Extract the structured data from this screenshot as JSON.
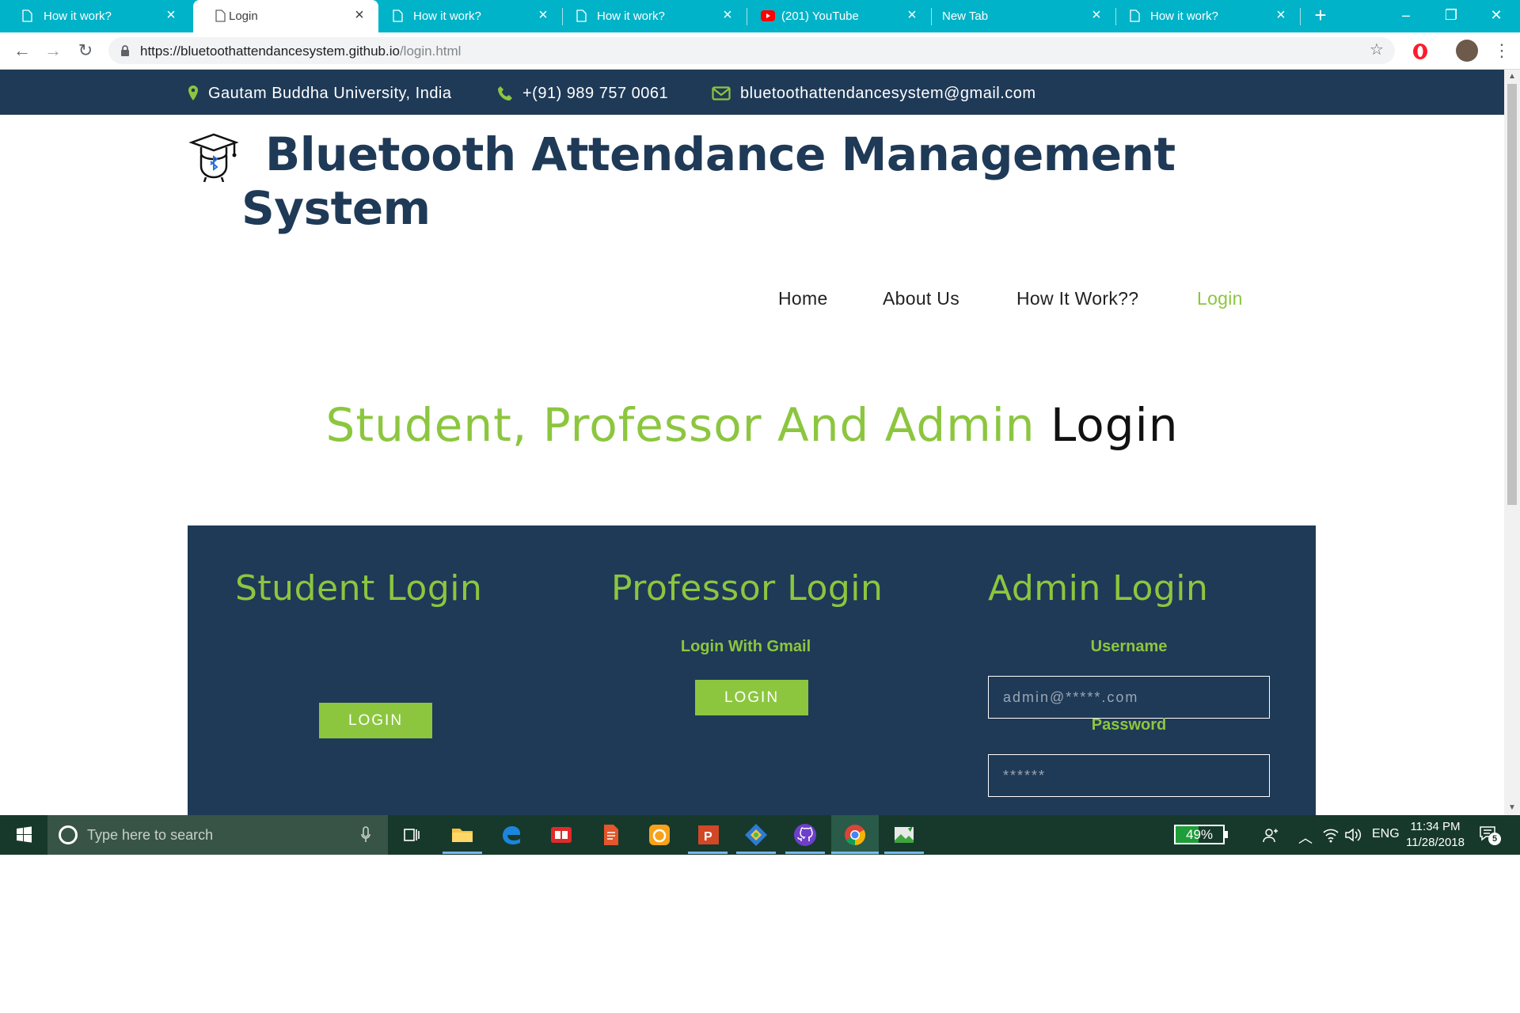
{
  "browser": {
    "tabs": [
      {
        "title": "How it work?",
        "icon": "page-icon",
        "active": false
      },
      {
        "title": "Login",
        "icon": "page-icon",
        "active": true
      },
      {
        "title": "How it work?",
        "icon": "page-icon",
        "active": false
      },
      {
        "title": "How it work?",
        "icon": "page-icon",
        "active": false
      },
      {
        "title": "(201) YouTube",
        "icon": "youtube-icon",
        "active": false
      },
      {
        "title": "New Tab",
        "icon": "none",
        "active": false
      },
      {
        "title": "How it work?",
        "icon": "page-icon",
        "active": false
      }
    ],
    "url_host": "https://bluetoothattendancesystem.github.io",
    "url_path": "/login.html"
  },
  "site": {
    "contact": {
      "location": "Gautam Buddha University, India",
      "phone": "+(91) 989 757 0061",
      "email": "bluetoothattendancesystem@gmail.com"
    },
    "brand_title": "Bluetooth Attendance Management System",
    "nav": [
      {
        "label": "Home",
        "active": false
      },
      {
        "label": "About Us",
        "active": false
      },
      {
        "label": "How It Work??",
        "active": false
      },
      {
        "label": "Login",
        "active": true
      }
    ],
    "heading_green": "Student, Professor And Admin",
    "heading_dark": "Login",
    "student": {
      "title": "Student Login",
      "button": "LOGIN"
    },
    "professor": {
      "title": "Professor Login",
      "subtitle": "Login With Gmail",
      "button": "LOGIN"
    },
    "admin": {
      "title": "Admin Login",
      "username_label": "Username",
      "username_placeholder": "admin@*****.com",
      "password_label": "Password",
      "password_placeholder": "******"
    },
    "colors": {
      "primary": "#1f3a57",
      "accent": "#8cc63f"
    }
  },
  "taskbar": {
    "search_placeholder": "Type here to search",
    "battery": "49%",
    "battery_level": 0.49,
    "language": "ENG",
    "time": "11:34 PM",
    "date": "11/28/2018",
    "notifications": "5"
  }
}
